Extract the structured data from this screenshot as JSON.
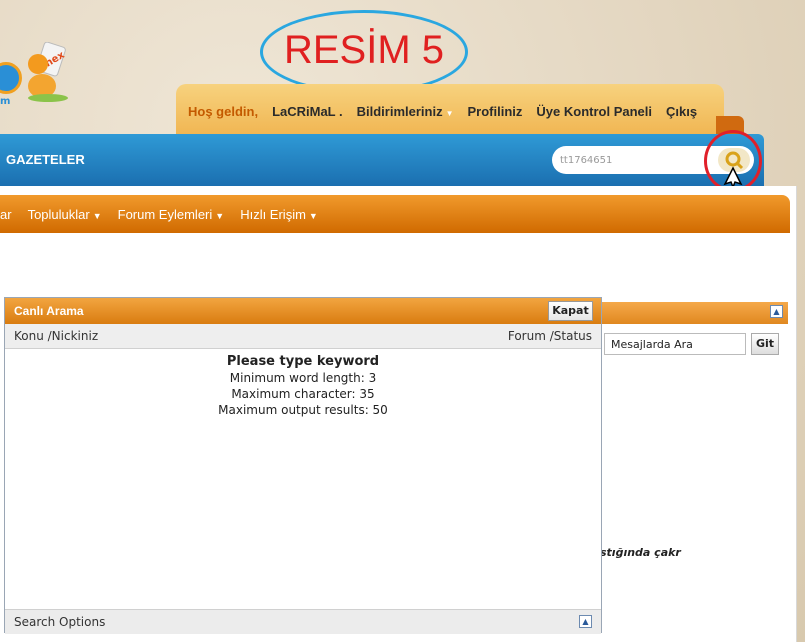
{
  "annotation": {
    "label": "RESİM 5"
  },
  "logo": {
    "fragment": "m",
    "badge": "nex"
  },
  "welcome": {
    "greeting": "Hoş geldin,",
    "username": "LaCRiMaL .",
    "notifications": "Bildirimleriniz",
    "profile": "Profiliniz",
    "control_panel": "Üye Kontrol Paneli",
    "logout": "Çıkış"
  },
  "navbar": {
    "title": "GAZETELER",
    "search_value": "tt1764651"
  },
  "menu": {
    "items": [
      "ar",
      "Topluluklar",
      "Forum Eylemleri",
      "Hızlı Erişim"
    ]
  },
  "background": {
    "search_field": "Mesajlarda Ara",
    "go_button": "Git",
    "snippet": "stığında çakr"
  },
  "live_search": {
    "title": "Canlı Arama",
    "close_button": "Kapat",
    "col_left": "Konu /Nickiniz",
    "col_right": "Forum /Status",
    "prompt": "Please type keyword",
    "min_length": "Minimum word length: 3",
    "max_char": "Maximum character: 35",
    "max_results": "Maximum output results: 50",
    "footer": "Search Options"
  },
  "colors": {
    "orange": "#d97c10",
    "blue": "#1b6fb0",
    "annotation_red": "#e02020",
    "annotation_blue": "#2aa7e0"
  }
}
